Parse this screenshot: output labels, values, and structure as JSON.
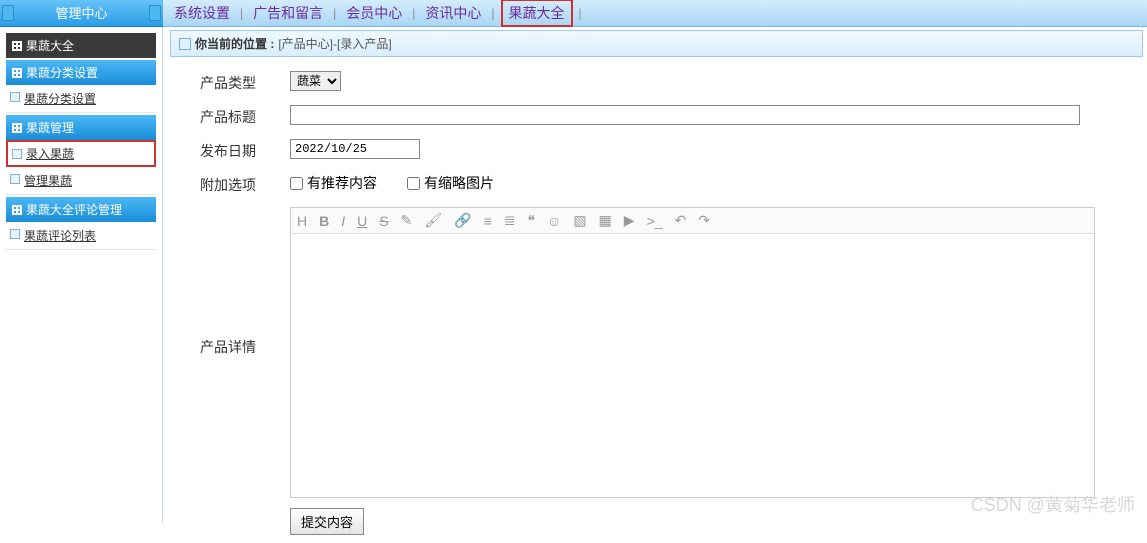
{
  "header": {
    "title": "管理中心"
  },
  "topnav": {
    "items": [
      "系统设置",
      "广告和留言",
      "会员中心",
      "资讯中心",
      "果蔬大全"
    ],
    "sep": "|",
    "highlighted_index": 4
  },
  "sidebar": {
    "root_title": "果蔬大全",
    "sections": [
      {
        "title": "果蔬分类设置",
        "items": [
          {
            "label": "果蔬分类设置",
            "hi": false
          }
        ]
      },
      {
        "title": "果蔬管理",
        "items": [
          {
            "label": "录入果蔬",
            "hi": true
          },
          {
            "label": "管理果蔬",
            "hi": false
          }
        ]
      },
      {
        "title": "果蔬大全评论管理",
        "items": [
          {
            "label": "果蔬评论列表",
            "hi": false
          }
        ]
      }
    ]
  },
  "breadcrumb": {
    "label": "你当前的位置 :",
    "path": "[产品中心]-[录入产品]"
  },
  "form": {
    "type_label": "产品类型",
    "type_value": "蔬菜",
    "title_label": "产品标题",
    "title_value": "",
    "date_label": "发布日期",
    "date_value": "2022/10/25",
    "extra_label": "附加选项",
    "check_recommend": "有推荐内容",
    "check_thumb": "有缩略图片",
    "detail_label": "产品详情",
    "submit": "提交内容"
  },
  "editor_toolbar": [
    "H",
    "B",
    "I",
    "U",
    "S",
    "✎",
    "🖌",
    "🔗",
    "≡",
    "≣",
    "❝",
    "☺",
    "▧",
    "▦",
    "▶",
    ">_",
    "↶",
    "↷"
  ],
  "watermark": "CSDN @黄菊华老师"
}
